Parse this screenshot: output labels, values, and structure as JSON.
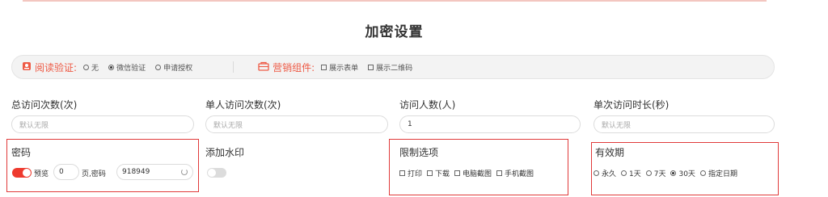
{
  "title": "加密设置",
  "bar": {
    "read_verify": {
      "label": "阅读验证:",
      "options": [
        "无",
        "微信验证",
        "申请授权"
      ],
      "selected": "微信验证"
    },
    "marketing": {
      "label": "营销组件:",
      "options": [
        "展示表单",
        "展示二维码"
      ]
    }
  },
  "fields": {
    "total_visits": {
      "label": "总访问次数(次)",
      "placeholder": "默认无限"
    },
    "single_visits": {
      "label": "单人访问次数(次)",
      "placeholder": "默认无限"
    },
    "visitors": {
      "label": "访问人数(人)",
      "value": "1"
    },
    "single_duration": {
      "label": "单次访问时长(秒)",
      "placeholder": "默认无限"
    }
  },
  "password": {
    "label": "密码",
    "preview_label": "预览",
    "pages_value": "0",
    "pages_suffix": "页,密码",
    "password_value": "918949",
    "toggle_on": true
  },
  "watermark": {
    "label": "添加水印",
    "toggle_on": false
  },
  "restrictions": {
    "label": "限制选项",
    "options": [
      "打印",
      "下载",
      "电脑截图",
      "手机截图"
    ]
  },
  "validity": {
    "label": "有效期",
    "options": [
      "永久",
      "1天",
      "7天",
      "30天",
      "指定日期"
    ],
    "selected": "30天"
  },
  "colors": {
    "accent": "#ee5a45",
    "highlight_border": "#e03a3a",
    "toggle_on": "#ee3a2e"
  }
}
